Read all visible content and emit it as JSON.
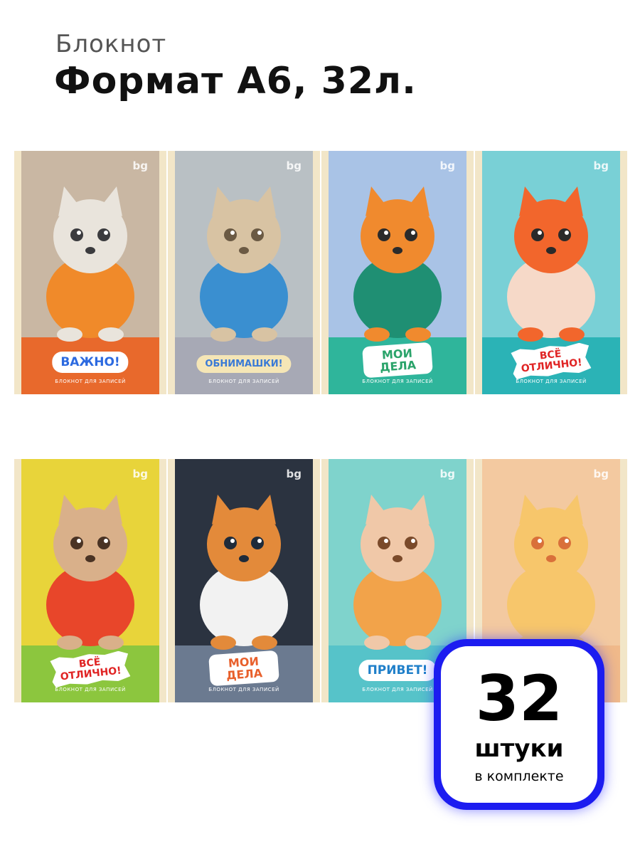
{
  "header": {
    "subtitle": "Блокнот",
    "title": "Формат А6, 32л."
  },
  "brand_logo": "bg",
  "cover_footer": "БЛОКНОТ ДЛЯ ЗАПИСЕЙ",
  "covers_row1": [
    {
      "animal": "husky-puppy",
      "badge": "ВАЖНО!",
      "badge_style": "pill",
      "bg": "#c9b7a3",
      "band": "#e8692c",
      "badge_bg": "#ffffff",
      "badge_color": "#2c6ae0"
    },
    {
      "animal": "teddy-bear",
      "badge": "ОБНИМАШКИ!",
      "badge_style": "pill",
      "bg": "#b9c0c4",
      "band": "#a7a9b5",
      "badge_bg": "#f5e6b6",
      "badge_color": "#3a7ad6"
    },
    {
      "animal": "tiger-cub",
      "badge": "МОИ ДЕЛА",
      "badge_style": "sticker",
      "bg": "#a9c3e6",
      "band": "#2fb59b",
      "badge_bg": "#ffffff",
      "badge_color": "#2aa36a"
    },
    {
      "animal": "fox",
      "badge": "ВСЁ ОТЛИЧНО!",
      "badge_style": "burst",
      "bg": "#79d0d6",
      "band": "#2bb3b6",
      "badge_bg": "#ffffff",
      "badge_color": "#e02424"
    }
  ],
  "covers_row2": [
    {
      "animal": "puppy-with-scarf",
      "badge": "ВСЁ ОТЛИЧНО!",
      "badge_style": "burst",
      "bg": "#e8d43a",
      "band": "#8cc63e",
      "badge_bg": "#ffffff",
      "badge_color": "#e02424"
    },
    {
      "animal": "cat-in-cap",
      "badge": "МОИ ДЕЛА",
      "badge_style": "sticker",
      "bg": "#2b3340",
      "band": "#6b7a90",
      "badge_bg": "#ffffff",
      "badge_color": "#e8602c"
    },
    {
      "animal": "hedgehog",
      "badge": "ПРИВЕТ!",
      "badge_style": "pill",
      "bg": "#7fd3cc",
      "band": "#56c3c9",
      "badge_bg": "#ffffff",
      "badge_color": "#1f7fc9"
    },
    {
      "animal": "duckling-in-cap",
      "badge": "",
      "badge_style": "none",
      "bg": "#f3c9a0",
      "band": "#f0b98a",
      "badge_bg": "#ffffff",
      "badge_color": "#e02424"
    }
  ],
  "promo": {
    "count": "32",
    "unit": "штуки",
    "note": "в комплекте",
    "border_color": "#1c1cf0"
  }
}
